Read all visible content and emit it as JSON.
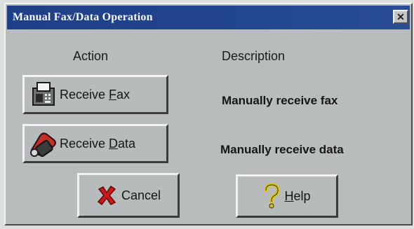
{
  "window": {
    "title": "Manual Fax/Data Operation",
    "close_glyph": "✕"
  },
  "columns": {
    "action": "Action",
    "description": "Description"
  },
  "rows": [
    {
      "button_prefix": "Receive ",
      "button_key": "F",
      "button_suffix": "ax",
      "icon": "fax-machine-icon",
      "description": "Manually receive fax"
    },
    {
      "button_prefix": "Receive ",
      "button_key": "D",
      "button_suffix": "ata",
      "icon": "telephone-handset-icon",
      "description": "Manually receive data"
    }
  ],
  "footer": {
    "cancel_label": "Cancel",
    "cancel_icon": "red-x-icon",
    "help_key": "H",
    "help_suffix": "elp",
    "help_icon": "question-mark-icon"
  },
  "colors": {
    "titlebar": "#1f3f86",
    "dialog_face": "#b9bcbc",
    "cancel_x": "#d0161a",
    "help_q": "#d8c21a"
  }
}
